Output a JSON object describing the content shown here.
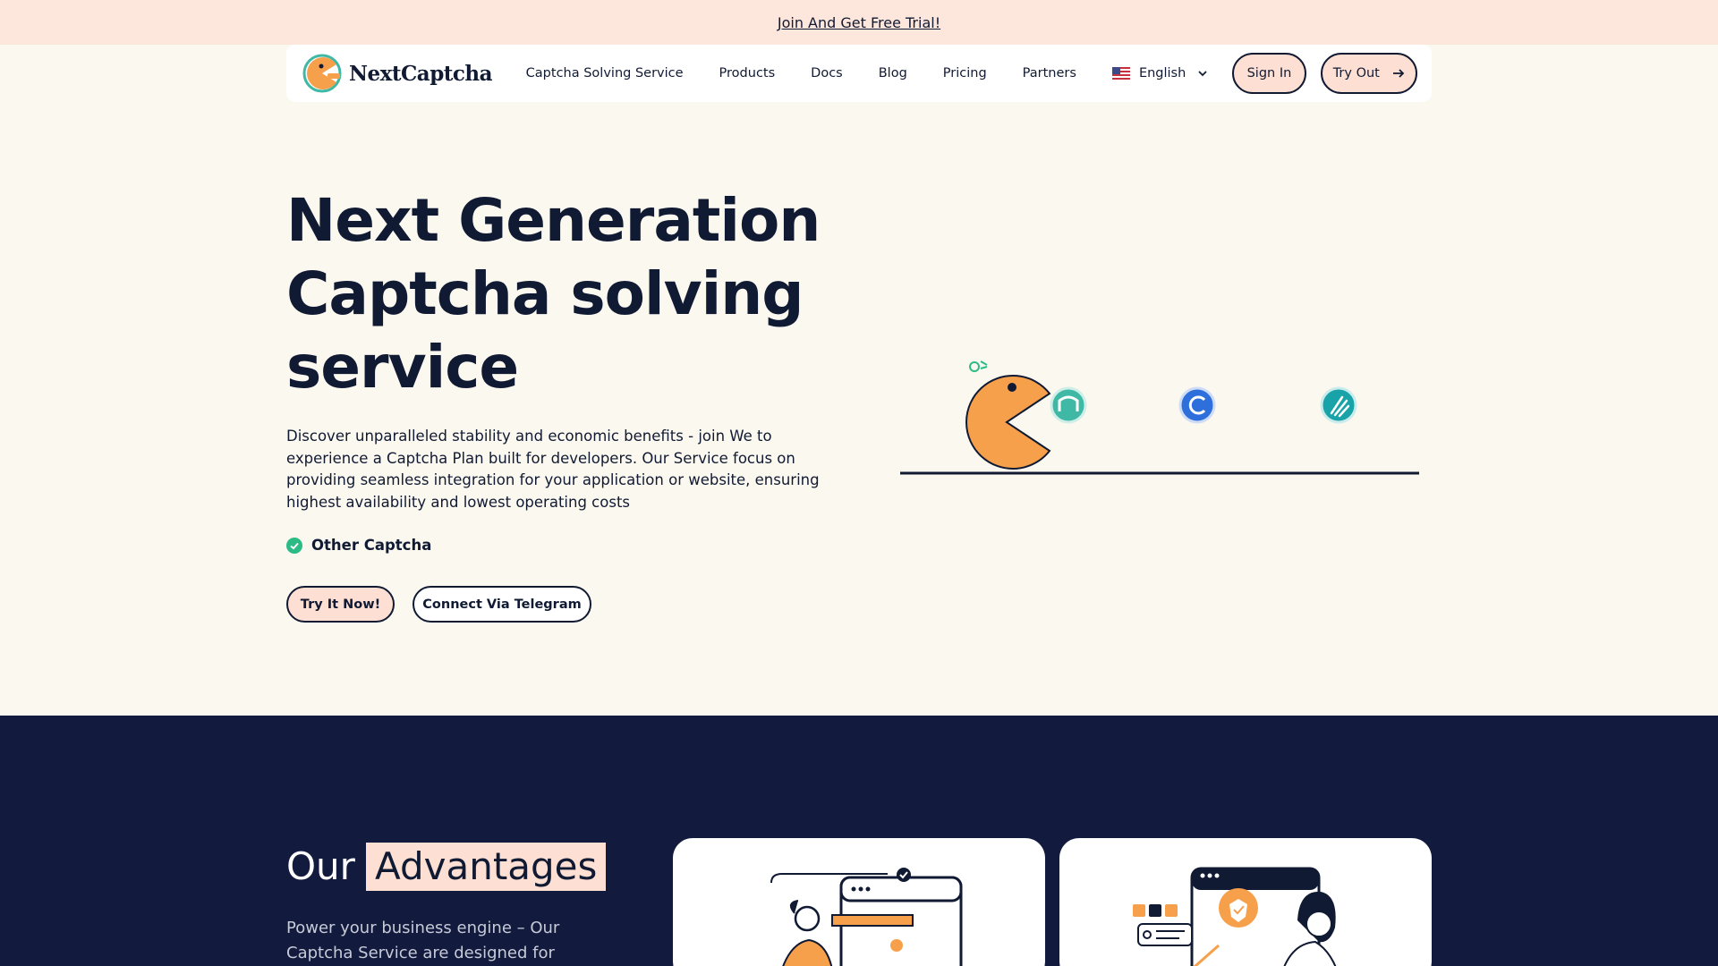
{
  "promo": {
    "link_text": "Join And Get Free Trial!"
  },
  "nav": {
    "brand": "NextCaptcha",
    "links": [
      "Captcha Solving Service",
      "Products",
      "Docs",
      "Blog",
      "Pricing",
      "Partners"
    ],
    "language": "English",
    "sign_in": "Sign In",
    "try_out": "Try Out"
  },
  "hero": {
    "title": "Next Generation Captcha solving service",
    "description": "Discover unparalleled stability and economic benefits - join We to experience a Captcha Plan built for developers. Our Service focus on providing seamless integration for your application or website, ensuring highest availability and lowest operating costs",
    "feature": "Other Captcha",
    "cta_primary": "Try It Now!",
    "cta_secondary": "Connect Via Telegram"
  },
  "advantages": {
    "title_plain": "Our",
    "title_highlight": "Advantages",
    "description": "Power your business engine – Our Captcha Service are designed for"
  },
  "colors": {
    "promo_bg": "#fde7dc",
    "page_bg": "#fbf8ef",
    "navy": "#111a33",
    "dark_section": "#121a3d",
    "accent_peach": "#fde0d3",
    "accent_orange": "#f7a04b",
    "check_green": "#2dbb85"
  },
  "icons": [
    "brand-logo-icon",
    "us-flag-icon",
    "chevron-down-icon",
    "arrow-right-icon",
    "check-circle-icon",
    "pacman-mascot-icon",
    "captcha-logo-teal-icon",
    "captcha-logo-blue-icon",
    "captcha-logo-hand-icon"
  ]
}
